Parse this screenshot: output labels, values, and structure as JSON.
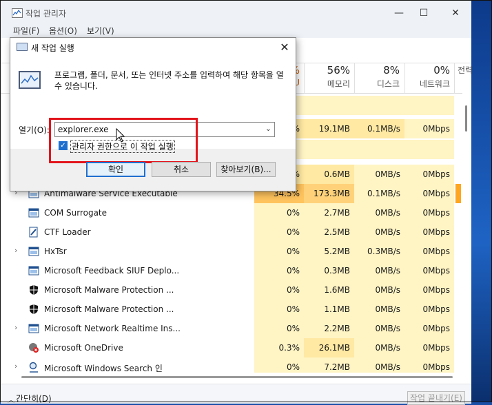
{
  "window": {
    "title": "작업 관리자",
    "minimize_glyph": "—",
    "maximize_glyph": "☐",
    "close_glyph": "✕"
  },
  "menu": [
    "파일(F)",
    "옵션(O)",
    "보기(V)"
  ],
  "columns": [
    {
      "key": "cpu",
      "pct": "%",
      "label": "U"
    },
    {
      "key": "mem",
      "pct": "56%",
      "label": "메모리"
    },
    {
      "key": "disk",
      "pct": "8%",
      "label": "디스크"
    },
    {
      "key": "net",
      "pct": "0%",
      "label": "네트워크"
    },
    {
      "key": "power",
      "pct": "",
      "label": "전력"
    }
  ],
  "hidden_rows": [
    {
      "cpu": "%",
      "mem": "19.1MB",
      "disk": "0.1MB/s",
      "net": "0Mbps"
    },
    {
      "cpu": "%",
      "mem": "0.6MB",
      "disk": "0MB/s",
      "net": "0Mbps"
    }
  ],
  "processes": [
    {
      "expand": true,
      "name": "Antimalware Service Executable",
      "icon": "app-window-icon",
      "cpu": "34.5%",
      "mem": "173.3MB",
      "disk": "0.1MB/s",
      "net": "0Mbps"
    },
    {
      "expand": false,
      "name": "COM Surrogate",
      "icon": "app-window-icon",
      "cpu": "0%",
      "mem": "2.7MB",
      "disk": "0MB/s",
      "net": "0Mbps"
    },
    {
      "expand": false,
      "name": "CTF Loader",
      "icon": "ctf-loader-icon",
      "cpu": "0%",
      "mem": "2.5MB",
      "disk": "0MB/s",
      "net": "0Mbps"
    },
    {
      "expand": true,
      "name": "HxTsr",
      "icon": "app-window-icon",
      "cpu": "0%",
      "mem": "5.2MB",
      "disk": "0.3MB/s",
      "net": "0Mbps"
    },
    {
      "expand": false,
      "name": "Microsoft Feedback SIUF Deplo...",
      "icon": "app-window-icon",
      "cpu": "0%",
      "mem": "0.3MB",
      "disk": "0MB/s",
      "net": "0Mbps"
    },
    {
      "expand": false,
      "name": "Microsoft Malware Protection ...",
      "icon": "shield-icon",
      "cpu": "0%",
      "mem": "1.6MB",
      "disk": "0MB/s",
      "net": "0Mbps"
    },
    {
      "expand": false,
      "name": "Microsoft Malware Protection ...",
      "icon": "shield-icon",
      "cpu": "0%",
      "mem": "1.1MB",
      "disk": "0MB/s",
      "net": "0Mbps"
    },
    {
      "expand": true,
      "name": "Microsoft Network Realtime Ins...",
      "icon": "app-window-icon",
      "cpu": "0%",
      "mem": "2.2MB",
      "disk": "0MB/s",
      "net": "0Mbps"
    },
    {
      "expand": false,
      "name": "Microsoft OneDrive",
      "icon": "onedrive-icon",
      "cpu": "0.3%",
      "mem": "26.1MB",
      "disk": "0MB/s",
      "net": "0Mbps"
    },
    {
      "expand": true,
      "name": "Microsoft Windows Search 인",
      "icon": "search-icon",
      "cpu": "0%",
      "mem": "7.2MB",
      "disk": "0MB/s",
      "net": "0Mbps"
    }
  ],
  "footer": {
    "less_details": "간단히(D)",
    "end_task": "작업 끝내기(E)"
  },
  "run_dialog": {
    "title": "새 작업 실행",
    "close_glyph": "✕",
    "message": "프로그램, 폴더, 문서, 또는 인터넷 주소를 입력하여 해당 항목을 열 수 있습니다.",
    "open_label": "열기(O):",
    "open_value": "explorer.exe",
    "admin_checkbox_label": "관리자 권한으로 이 작업 실행",
    "admin_checked": true,
    "ok_label": "확인",
    "cancel_label": "취소",
    "browse_label": "찾아보기(B)..."
  },
  "colors": {
    "highlight": "#e3141b",
    "accent": "#1f6fce",
    "cpu_hot": "#ffc45e",
    "heat_light": "#fff4c4"
  }
}
